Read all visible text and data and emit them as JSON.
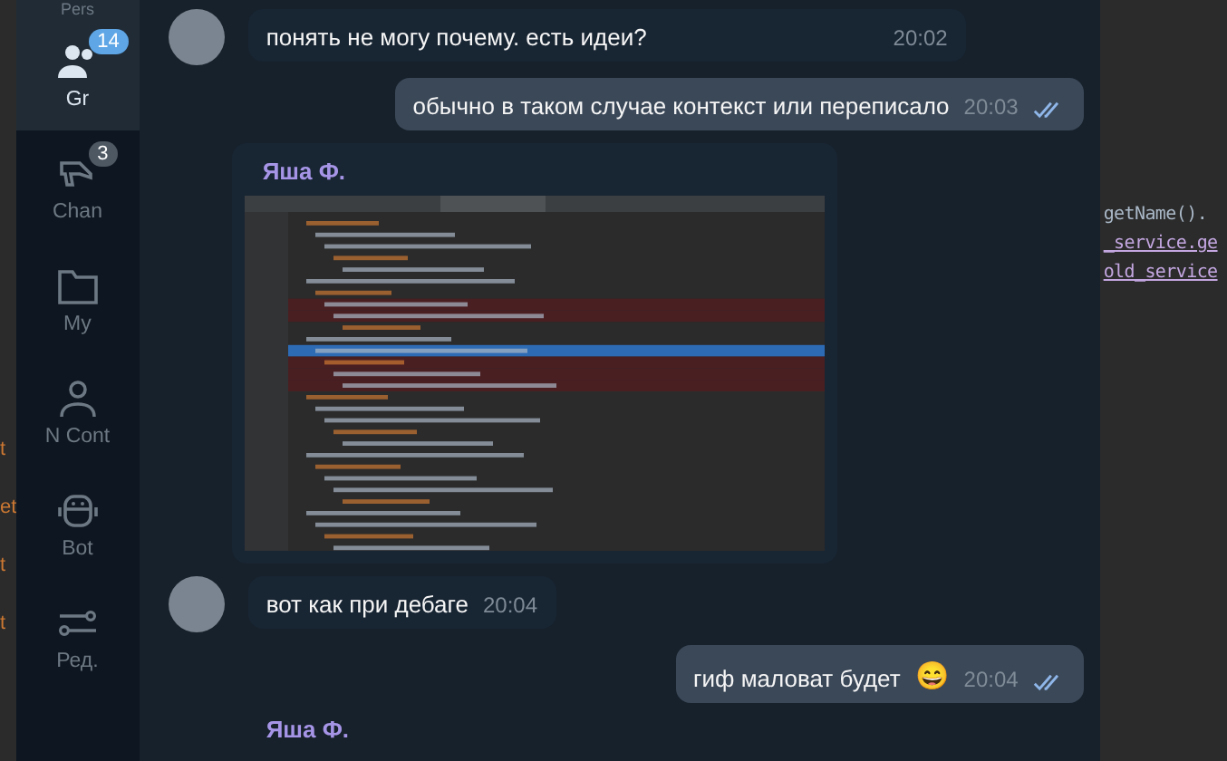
{
  "ide_left": {
    "fragments": [
      "t",
      "et",
      "t",
      "t"
    ]
  },
  "sidebar": {
    "items": [
      {
        "label": "Pers",
        "selected": false
      },
      {
        "label": "Gr",
        "selected": true,
        "badge": "14",
        "badge_muted": false
      },
      {
        "label": "Chan",
        "selected": false,
        "badge": "3",
        "badge_muted": true
      },
      {
        "label": "My",
        "selected": false
      },
      {
        "label": "N Cont",
        "selected": false
      },
      {
        "label": "Bot",
        "selected": false
      },
      {
        "label": "Ред.",
        "selected": false
      }
    ]
  },
  "messages": [
    {
      "kind": "in",
      "text": "понять не могу почему. есть идеи?",
      "time": "20:02"
    },
    {
      "kind": "out",
      "text": "обычно в таком случае контекст или переписало",
      "time": "20:03",
      "read": true
    },
    {
      "kind": "image",
      "sender": "Яша Ф."
    },
    {
      "kind": "in",
      "text": "вот как при дебаге",
      "time": "20:04"
    },
    {
      "kind": "out",
      "text": "гиф маловат будет",
      "emoji": "😄",
      "time": "20:04",
      "read": true
    },
    {
      "kind": "name",
      "sender": "Яша Ф."
    }
  ],
  "ide_right": {
    "lines": [
      "getName().",
      "_service.ge",
      "old_service"
    ]
  }
}
